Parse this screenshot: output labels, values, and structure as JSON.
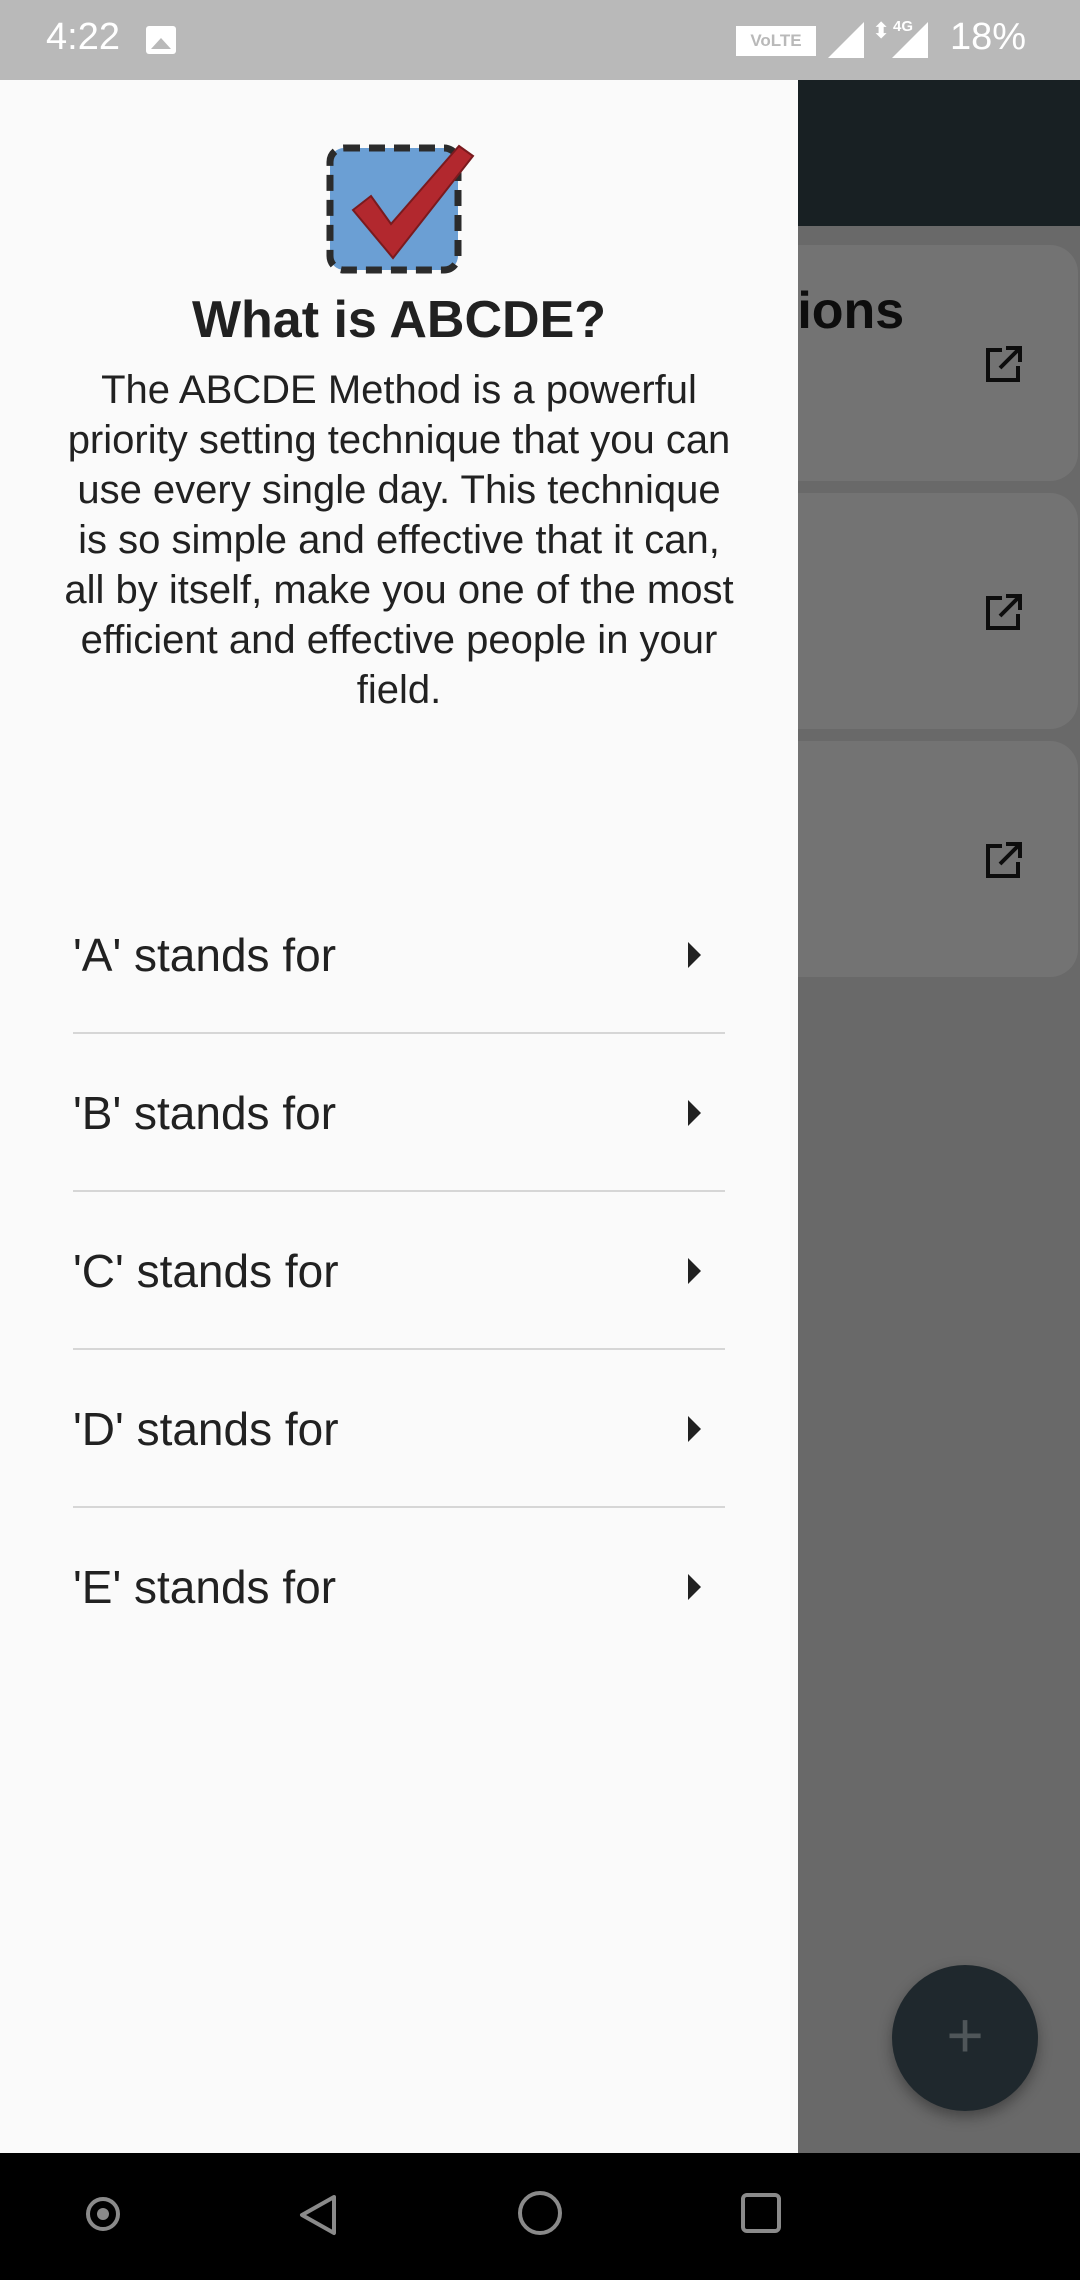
{
  "status_bar": {
    "time": "4:22",
    "volte_label": "VoLTE",
    "network": "4G",
    "battery": "18%"
  },
  "background_app": {
    "card_title_fragment": "tions",
    "fab_label": "+"
  },
  "drawer": {
    "title": "What is ABCDE?",
    "description": "The ABCDE Method is a powerful priority setting technique that you can use every single day. This technique is so simple and effective that it can, all by itself, make you one of the most efficient and effective people in your field.",
    "items": [
      {
        "label": "'A' stands for"
      },
      {
        "label": "'B' stands for"
      },
      {
        "label": "'C' stands for"
      },
      {
        "label": "'D' stands for"
      },
      {
        "label": "'E' stands for"
      }
    ]
  },
  "colors": {
    "status_bar": "#b9b9b9",
    "app_bar": "#37474f",
    "fab": "#455a64",
    "drawer_bg": "#fafafa",
    "logo_blue": "#6b9fd4",
    "logo_check": "#b2282e"
  },
  "icons": {
    "logo": "checkbox-checkmark-icon",
    "item_trailing": "caret-right-icon",
    "card_action": "open-in-new-icon"
  }
}
